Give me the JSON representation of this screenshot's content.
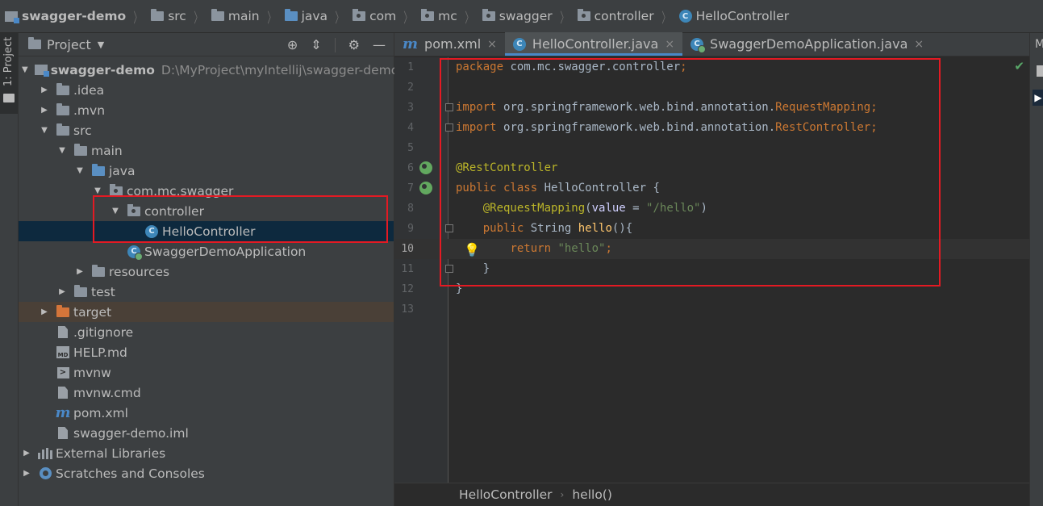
{
  "breadcrumb": [
    {
      "label": "swagger-demo",
      "icon": "module-icon"
    },
    {
      "label": "src",
      "icon": "folder-icon"
    },
    {
      "label": "main",
      "icon": "folder-icon"
    },
    {
      "label": "java",
      "icon": "source-folder-icon"
    },
    {
      "label": "com",
      "icon": "package-icon"
    },
    {
      "label": "mc",
      "icon": "package-icon"
    },
    {
      "label": "swagger",
      "icon": "package-icon"
    },
    {
      "label": "controller",
      "icon": "package-icon"
    },
    {
      "label": "HelloController",
      "icon": "class-icon"
    }
  ],
  "toolstrip": {
    "project_label": "1: Project"
  },
  "project_panel": {
    "title": "Project",
    "tree": [
      {
        "label": "swagger-demo",
        "path": "D:\\MyProject\\myIntellij\\swagger-demo",
        "icon": "module-icon",
        "depth": 0,
        "arrow": "down"
      },
      {
        "label": ".idea",
        "icon": "folder-icon",
        "depth": 1,
        "arrow": "right"
      },
      {
        "label": ".mvn",
        "icon": "folder-icon",
        "depth": 1,
        "arrow": "right"
      },
      {
        "label": "src",
        "icon": "folder-icon",
        "depth": 1,
        "arrow": "down"
      },
      {
        "label": "main",
        "icon": "folder-icon",
        "depth": 2,
        "arrow": "down"
      },
      {
        "label": "java",
        "icon": "source-folder-icon",
        "depth": 3,
        "arrow": "down"
      },
      {
        "label": "com.mc.swagger",
        "icon": "package-icon",
        "depth": 4,
        "arrow": "down"
      },
      {
        "label": "controller",
        "icon": "package-icon",
        "depth": 5,
        "arrow": "down"
      },
      {
        "label": "HelloController",
        "icon": "class-icon",
        "depth": 6,
        "arrow": "none",
        "selected": true
      },
      {
        "label": "SwaggerDemoApplication",
        "icon": "spring-boot-class-icon",
        "depth": 5,
        "arrow": "none"
      },
      {
        "label": "resources",
        "icon": "resources-folder-icon",
        "depth": 3,
        "arrow": "right"
      },
      {
        "label": "test",
        "icon": "folder-icon",
        "depth": 2,
        "arrow": "right"
      },
      {
        "label": "target",
        "icon": "excluded-folder-icon",
        "depth": 1,
        "arrow": "right",
        "excluded": true
      },
      {
        "label": ".gitignore",
        "icon": "file-icon",
        "depth": 1,
        "arrow": "none"
      },
      {
        "label": "HELP.md",
        "icon": "markdown-icon",
        "depth": 1,
        "arrow": "none"
      },
      {
        "label": "mvnw",
        "icon": "terminal-icon",
        "depth": 1,
        "arrow": "none"
      },
      {
        "label": "mvnw.cmd",
        "icon": "file-icon",
        "depth": 1,
        "arrow": "none"
      },
      {
        "label": "pom.xml",
        "icon": "maven-icon",
        "depth": 1,
        "arrow": "none"
      },
      {
        "label": "swagger-demo.iml",
        "icon": "file-icon",
        "depth": 1,
        "arrow": "none"
      },
      {
        "label": "External Libraries",
        "icon": "libraries-icon",
        "depth": 0,
        "arrow": "right"
      },
      {
        "label": "Scratches and Consoles",
        "icon": "scratches-icon",
        "depth": 0,
        "arrow": "right"
      }
    ]
  },
  "editor": {
    "tabs": [
      {
        "label": "pom.xml",
        "icon": "maven-icon",
        "active": false
      },
      {
        "label": "HelloController.java",
        "icon": "class-icon",
        "active": true
      },
      {
        "label": "SwaggerDemoApplication.java",
        "icon": "spring-boot-class-icon",
        "active": false
      }
    ],
    "line_numbers": [
      "1",
      "2",
      "3",
      "4",
      "5",
      "6",
      "7",
      "8",
      "9",
      "10",
      "11",
      "12",
      "13"
    ],
    "current_line": 10,
    "code_lines": [
      [
        {
          "t": "kw",
          "v": "package "
        },
        {
          "t": "plain",
          "v": "com.mc.swagger.controller"
        },
        {
          "t": "kw",
          "v": ";"
        }
      ],
      [],
      [
        {
          "t": "kw",
          "v": "import "
        },
        {
          "t": "plain",
          "v": "org.springframework.web.bind.annotation."
        },
        {
          "t": "imp",
          "v": "RequestMapping"
        },
        {
          "t": "kw",
          "v": ";"
        }
      ],
      [
        {
          "t": "kw",
          "v": "import "
        },
        {
          "t": "plain",
          "v": "org.springframework.web.bind.annotation."
        },
        {
          "t": "imp",
          "v": "RestController"
        },
        {
          "t": "kw",
          "v": ";"
        }
      ],
      [],
      [
        {
          "t": "ann",
          "v": "@RestController"
        }
      ],
      [
        {
          "t": "kw",
          "v": "public class "
        },
        {
          "t": "plain",
          "v": "HelloController {"
        }
      ],
      [
        {
          "t": "plain",
          "v": "    "
        },
        {
          "t": "ann",
          "v": "@RequestMapping"
        },
        {
          "t": "plain",
          "v": "("
        },
        {
          "t": "param",
          "v": "value"
        },
        {
          "t": "plain",
          "v": " = "
        },
        {
          "t": "str",
          "v": "\"/hello\""
        },
        {
          "t": "plain",
          "v": ")"
        }
      ],
      [
        {
          "t": "plain",
          "v": "    "
        },
        {
          "t": "kw",
          "v": "public "
        },
        {
          "t": "plain",
          "v": "String "
        },
        {
          "t": "fn",
          "v": "hello"
        },
        {
          "t": "plain",
          "v": "(){"
        }
      ],
      [
        {
          "t": "plain",
          "v": "        "
        },
        {
          "t": "kw",
          "v": "return "
        },
        {
          "t": "str",
          "v": "\"hello\""
        },
        {
          "t": "kw",
          "v": ";"
        }
      ],
      [
        {
          "t": "plain",
          "v": "    }"
        }
      ],
      [
        {
          "t": "plain",
          "v": "}"
        }
      ],
      []
    ],
    "status_breadcrumb": [
      "HelloController",
      "hello()"
    ]
  },
  "right_strip": {
    "label": "M"
  },
  "colors": {
    "highlight_box": "#e31a23",
    "accent": "#4a88c7",
    "keyword": "#cc7832",
    "annotation": "#bbb529",
    "string": "#6a8759"
  }
}
